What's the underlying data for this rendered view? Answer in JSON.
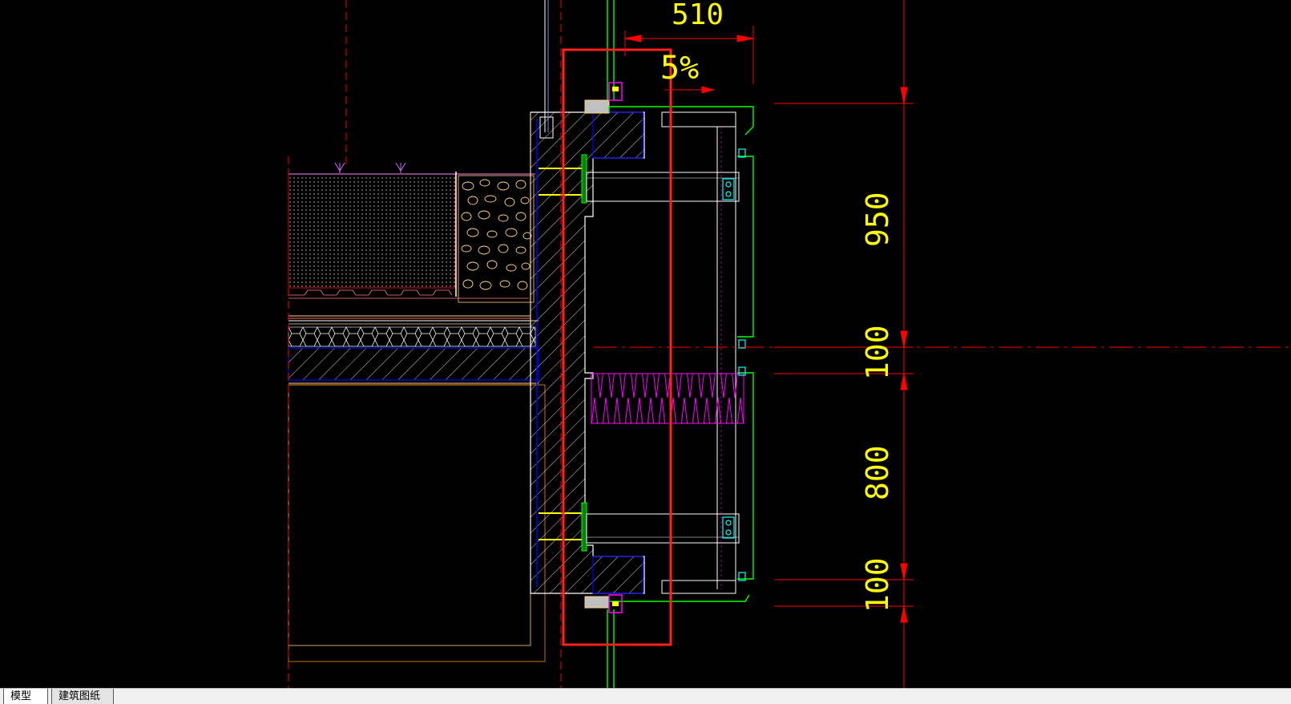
{
  "dimensions": {
    "top_width": "510",
    "slope": "5%",
    "h_950": "950",
    "h_100_a": "100",
    "h_800": "800",
    "h_100_b": "100"
  },
  "tabs": [
    {
      "label": "模型",
      "active": true
    },
    {
      "label": "建筑图纸",
      "active": false
    }
  ],
  "colors": {
    "background": "#000000",
    "dimension_line": "#ff0000",
    "dimension_text": "#ffff00",
    "highlight_box": "#ff2020",
    "concrete_outline": "#ffffff",
    "insulation": "#ff00ff",
    "aluminum_frame": "#00ff00",
    "waterproof_layer": "#0000ff",
    "gravel": "#ffd27f"
  }
}
